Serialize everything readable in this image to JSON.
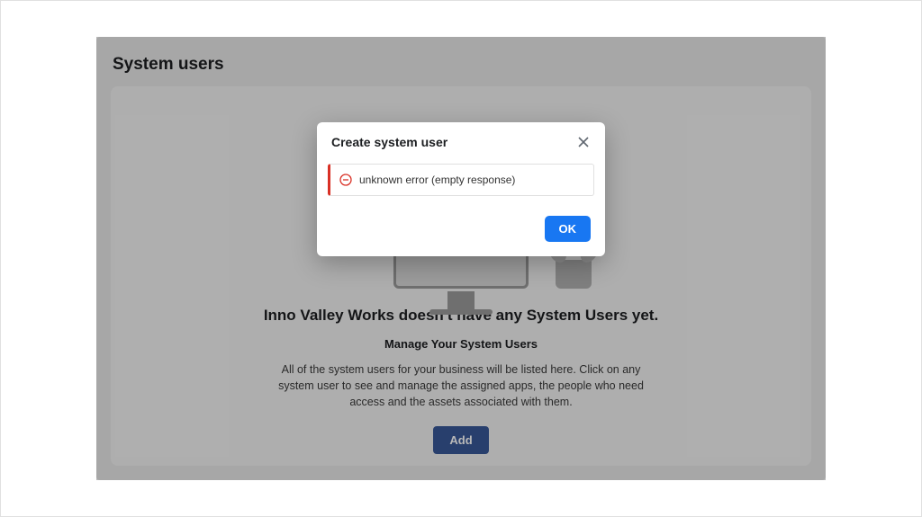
{
  "page": {
    "title": "System users"
  },
  "empty_state": {
    "heading": "Inno Valley Works doesn't have any System Users yet.",
    "subheading": "Manage Your System Users",
    "description": "All of the system users for your business will be listed here. Click on any system user to see and manage the assigned apps, the people who need access and the assets associated with them.",
    "add_button": "Add"
  },
  "modal": {
    "title": "Create system user",
    "error_message": "unknown error (empty response)",
    "ok_button": "OK"
  }
}
